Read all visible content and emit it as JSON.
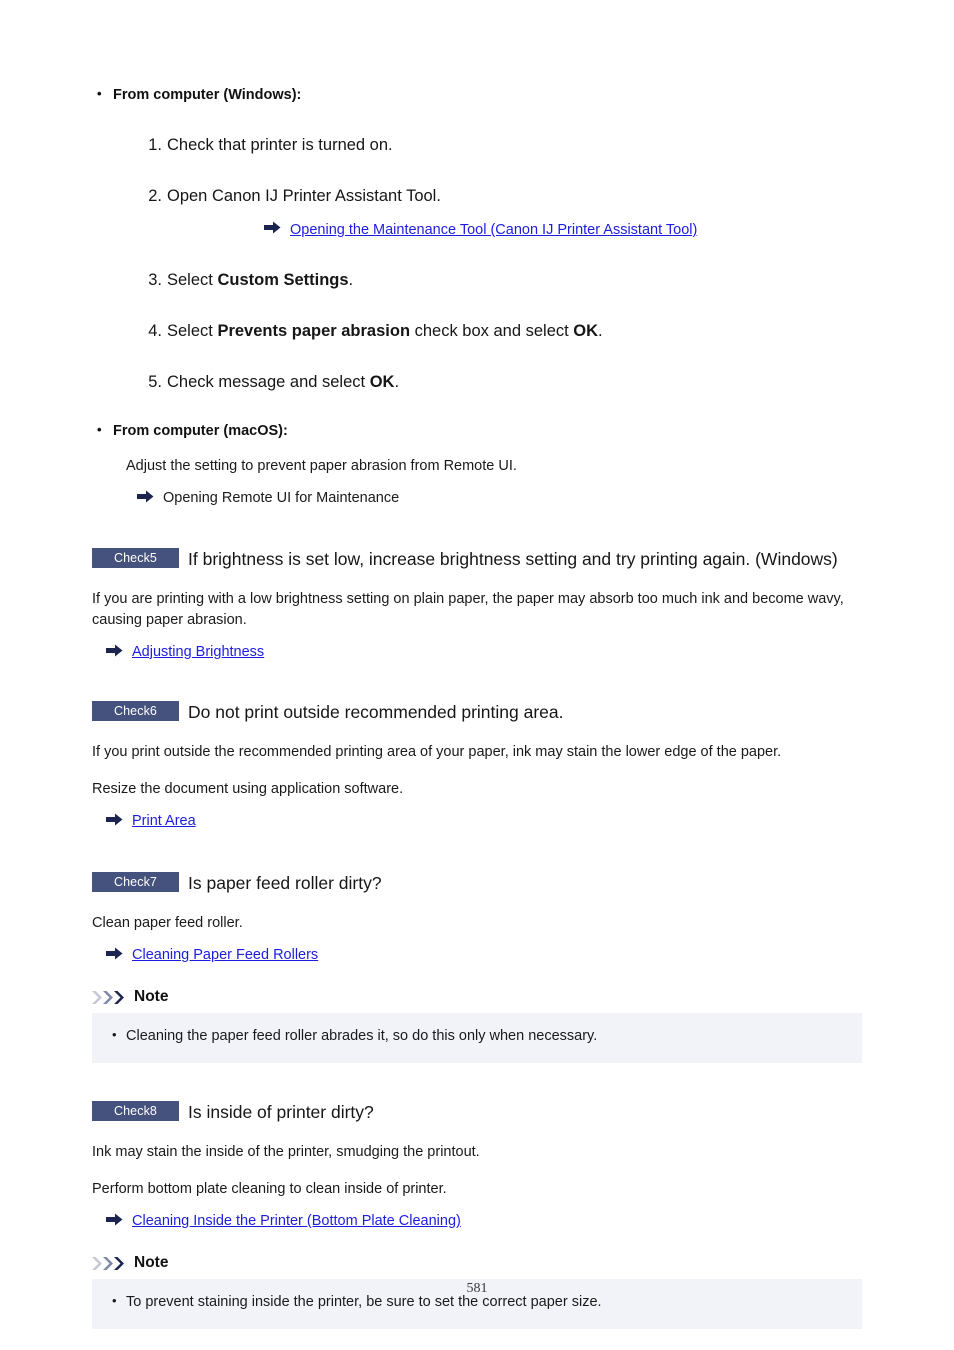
{
  "page": {
    "number": "581"
  },
  "procedure": {
    "windows": {
      "heading": "From computer (Windows):",
      "steps": [
        {
          "num": "1.",
          "text_before": "Check that printer is turned on.",
          "bold": "",
          "text_after": ""
        },
        {
          "num": "2.",
          "text_before": "Open Canon IJ Printer Assistant Tool.",
          "bold": "",
          "text_after": ""
        },
        {
          "num": "3.",
          "text_before": "Select ",
          "bold": "Custom Settings",
          "text_after": "."
        },
        {
          "num": "4.",
          "text_before": "Select ",
          "bold": "Prevents paper abrasion",
          "text_after": " check box and select ",
          "bold2": "OK",
          "text_after2": "."
        },
        {
          "num": "5.",
          "text_before": "Check message and select ",
          "bold": "OK",
          "text_after": "."
        }
      ],
      "step2_link": "Opening the Maintenance Tool (Canon IJ Printer Assistant Tool)"
    },
    "macos": {
      "heading": "From computer (macOS):",
      "body": "Adjust the setting to prevent paper abrasion from Remote UI.",
      "reference": "Opening Remote UI for Maintenance"
    }
  },
  "checks": [
    {
      "badge": "Check5",
      "title": "If brightness is set low, increase brightness setting and try printing again. (Windows)",
      "paragraphs": [
        "If you are printing with a low brightness setting on plain paper, the paper may absorb too much ink and become wavy, causing paper abrasion."
      ],
      "link": "Adjusting Brightness"
    },
    {
      "badge": "Check6",
      "title": "Do not print outside recommended printing area.",
      "paragraphs": [
        "If you print outside the recommended printing area of your paper, ink may stain the lower edge of the paper.",
        "Resize the document using application software."
      ],
      "link": "Print Area"
    },
    {
      "badge": "Check7",
      "title": "Is paper feed roller dirty?",
      "paragraphs": [
        "Clean paper feed roller."
      ],
      "link": "Cleaning Paper Feed Rollers",
      "note": {
        "label": "Note",
        "items": [
          "Cleaning the paper feed roller abrades it, so do this only when necessary."
        ]
      }
    },
    {
      "badge": "Check8",
      "title": "Is inside of printer dirty?",
      "paragraphs": [
        "Ink may stain the inside of the printer, smudging the printout.",
        "Perform bottom plate cleaning to clean inside of printer."
      ],
      "link": "Cleaning Inside the Printer (Bottom Plate Cleaning)",
      "note": {
        "label": "Note",
        "items": [
          "To prevent staining inside the printer, be sure to set the correct paper size."
        ]
      }
    }
  ],
  "colors": {
    "badge_bg": "#44527d",
    "link": "#1d1de0",
    "note_bg": "#f2f3f9",
    "arrow": "#1c2550"
  }
}
